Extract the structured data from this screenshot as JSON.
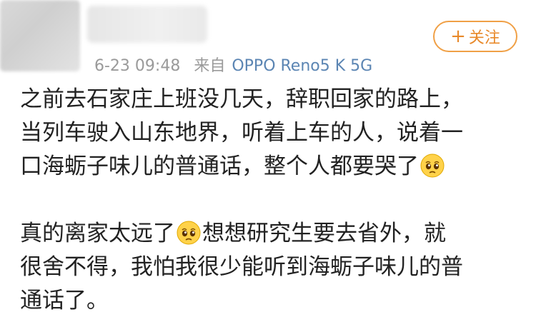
{
  "header": {
    "timestamp": "6-23 09:48",
    "source_prefix": "来自",
    "device": "OPPO Reno5 K 5G",
    "follow_label": "关注",
    "follow_icon": "plus-icon"
  },
  "post": {
    "paragraph1": {
      "line1": "之前去石家庄上班没几天，辞职回家的路上，",
      "line2": "当列车驶入山东地界，听着上车的人，说着一",
      "line3": "口海蛎子味儿的普通话，整个人都要哭了"
    },
    "paragraph2": {
      "line1a": "真的离家太远了",
      "line1b": "想想研究生要去省外，就",
      "line2": "很舍不得，我怕我很少能听到海蛎子味儿的普",
      "line3": "通话了。"
    },
    "emoji_name": "pleading-face-emoji"
  },
  "colors": {
    "accent_orange": "#e8892a",
    "device_blue": "#5b85b3",
    "meta_gray": "#9a9a9a"
  }
}
